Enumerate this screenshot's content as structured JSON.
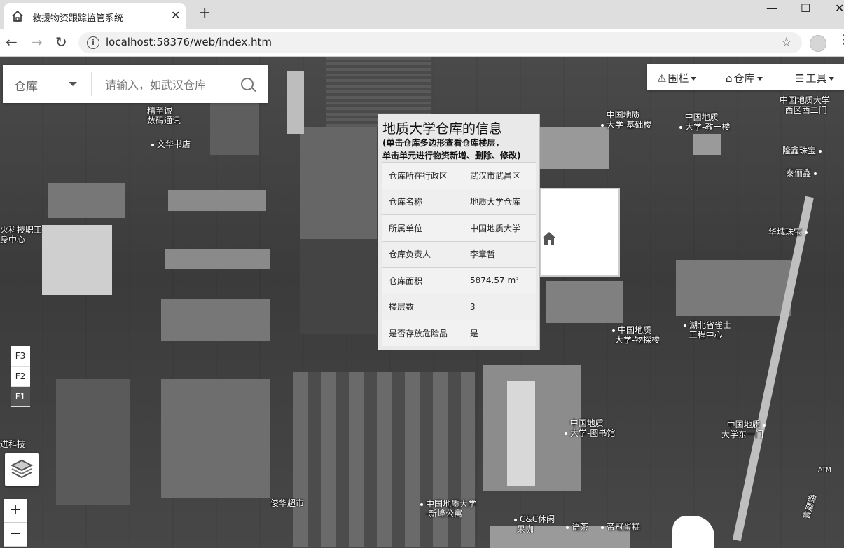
{
  "browser": {
    "tab_title": "救援物资跟踪监管系统",
    "url": "localhost:58376/web/index.htm",
    "tab_close": "✕",
    "new_tab": "+",
    "win_min": "—",
    "win_max": "☐",
    "win_close": "✕"
  },
  "search": {
    "category": "仓库",
    "placeholder": "请输入，如武汉仓库"
  },
  "map_toolbar": {
    "fence": "围栏",
    "warehouse": "仓库",
    "tools": "工具"
  },
  "popup": {
    "title": "地质大学仓库的信息",
    "hint_line1": "(单击仓库多边形查看仓库楼层，",
    "hint_line2": "单击单元进行物资新增、删除、修改)",
    "rows": [
      {
        "key": "仓库所在行政区",
        "value": "武汉市武昌区"
      },
      {
        "key": "仓库名称",
        "value": "地质大学仓库"
      },
      {
        "key": "所属单位",
        "value": "中国地质大学"
      },
      {
        "key": "仓库负责人",
        "value": "李章哲"
      },
      {
        "key": "仓库面积",
        "value": "5874.57 m²"
      },
      {
        "key": "楼层数",
        "value": "3"
      },
      {
        "key": "是否存放危险品",
        "value": "是"
      }
    ]
  },
  "floors": [
    "F3",
    "F2",
    "F1"
  ],
  "active_floor": "F1",
  "zoom": {
    "in": "+",
    "out": "−"
  },
  "map_labels": {
    "l1": "精至诚",
    "l1b": "数码通讯",
    "l2": "文华书店",
    "l3": "中国地质",
    "l3b": "大学-基础楼",
    "l4": "中国地质",
    "l4b": "大学-教一楼",
    "l5": "中国地质大学",
    "l5b": "西区西二门",
    "l6": "隆鑫珠宝",
    "l7": "泰俪鑫",
    "l8": "华城珠宝",
    "l9": "火科技职工",
    "l9b": "身中心",
    "l10": "中国地质",
    "l10b": "大学-物探楼",
    "l11": "湖北省雀士",
    "l11b": "工程中心",
    "l12": "中国地质",
    "l12b": "大学-图书馆",
    "l13": "中国地质",
    "l13b": "大学东一门",
    "l14": "俊华超市",
    "l15": "中国地质大学",
    "l15b": "-新峰公寓",
    "l16": "C&C休闲",
    "l16b": "果咖",
    "l17": "语茶",
    "l18": "帝冠蛋糕",
    "l19": "鲁磨路",
    "l20": "进科技",
    "l21": "ATM"
  }
}
